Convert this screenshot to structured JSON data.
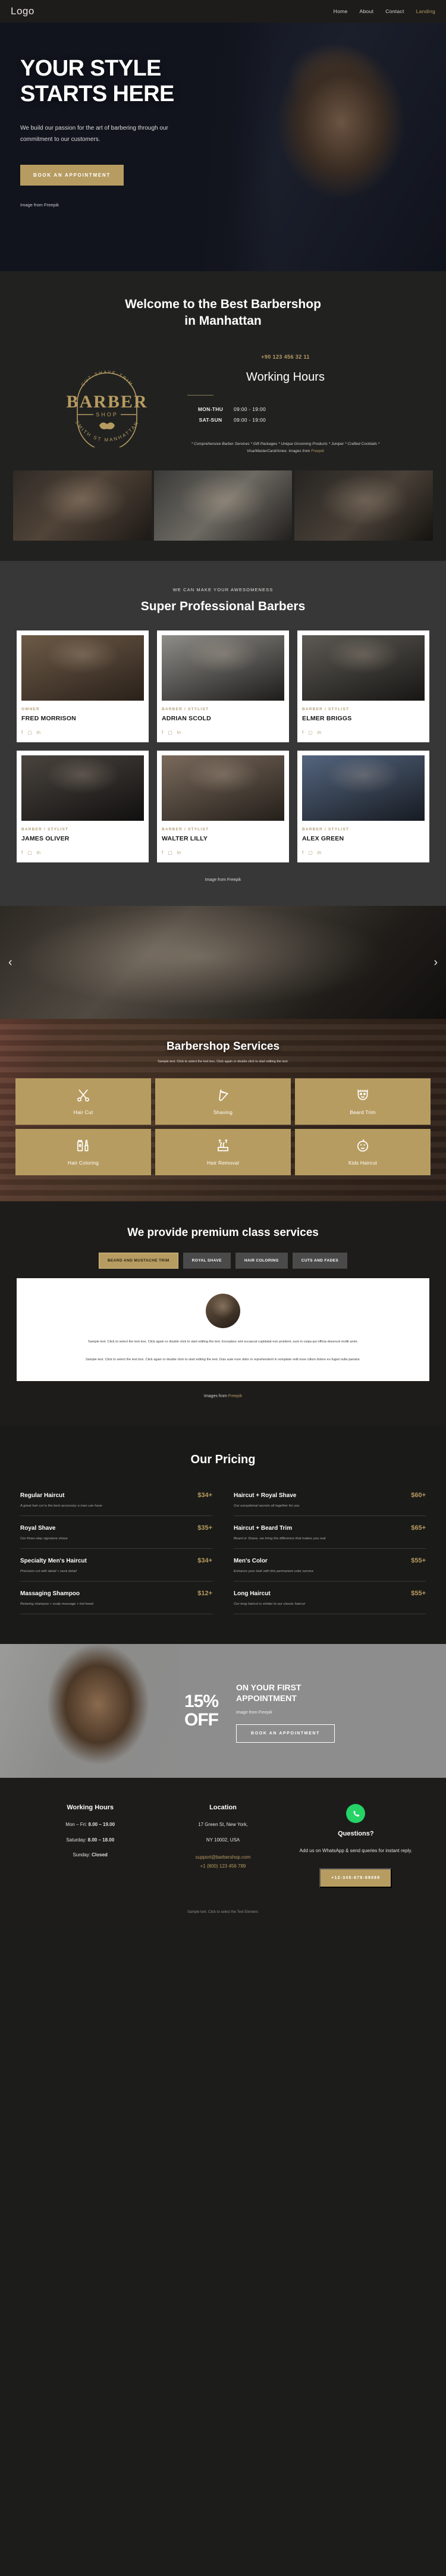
{
  "header": {
    "logo": "Logo",
    "nav": [
      {
        "label": "Home",
        "active": false
      },
      {
        "label": "About",
        "active": false
      },
      {
        "label": "Contact",
        "active": false
      },
      {
        "label": "Landing",
        "active": true
      }
    ]
  },
  "hero": {
    "title_line1": "YOUR STYLE",
    "title_line2": "STARTS HERE",
    "subtitle": "We build our passion for the art of barbering through our commitment to our customers.",
    "cta": "BOOK AN APPOINTMENT",
    "credit_prefix": "Image from ",
    "credit_link": "Freepik"
  },
  "welcome": {
    "title_line1": "Welcome to the Best Barbershop",
    "title_line2": "in Manhattan",
    "emblem": {
      "top_arc": "CUT·SHAVE·TRIM",
      "name": "BARBER",
      "sub": "SHOP",
      "bottom_arc": "SMITH ST MANHATTAN"
    },
    "phone": "+90 123 456 32 11",
    "hours_title": "Working Hours",
    "hours": [
      {
        "days": "MON-THU",
        "time": "09:00 - 19:00"
      },
      {
        "days": "SAT-SUN",
        "time": "09:00 - 19:00"
      }
    ],
    "fineprint": "* Comprehensive Barber Services * Gift Packages * Unique Grooming Products * Juniper * Crafted Cocktails *  Visa/MasterCard/Amex. Images from ",
    "fineprint_link": "Freepik"
  },
  "barbers": {
    "eyebrow": "WE CAN MAKE YOUR AWESOMENESS",
    "title": "Super Professional Barbers",
    "members": [
      {
        "role": "OWNER",
        "name": "FRED MORRISON"
      },
      {
        "role": "BARBER / STYLIST",
        "name": "ADRIAN SCOLD"
      },
      {
        "role": "BARBER / STYLIST",
        "name": "ELMER BRIGGS"
      },
      {
        "role": "BARBER / STYLIST",
        "name": "JAMES OLIVER"
      },
      {
        "role": "BARBER / STYLIST",
        "name": "WALTER LILLY"
      },
      {
        "role": "BARBER / STYLIST",
        "name": "ALEX GREEN"
      }
    ],
    "credit_prefix": "Image from ",
    "credit_link": "Freepik"
  },
  "slider": {
    "prev": "‹",
    "next": "›"
  },
  "services": {
    "title": "Barbershop Services",
    "subtitle": "Sample text. Click to select the text box. Click again or double click to start editing the text.",
    "items": [
      {
        "label": "Hair Cut",
        "icon": "scissors-icon"
      },
      {
        "label": "Shaving",
        "icon": "razor-icon"
      },
      {
        "label": "Beard Trim",
        "icon": "beard-icon"
      },
      {
        "label": "Hair Coloring",
        "icon": "color-tube-icon"
      },
      {
        "label": "Hair Removal",
        "icon": "hair-removal-icon"
      },
      {
        "label": "Kids Haircut",
        "icon": "baby-face-icon"
      }
    ]
  },
  "premium": {
    "title": "We provide premium class services",
    "tabs": [
      {
        "label": "BEARD AND MUSTACHE TRIM",
        "active": true
      },
      {
        "label": "ROYAL SHAVE",
        "active": false
      },
      {
        "label": "HAIR COLORING",
        "active": false
      },
      {
        "label": "CUTS AND FADES",
        "active": false
      }
    ],
    "body_line1": "Sample text. Click to select the text box. Click again or double click to start editing the text. Excepteur sint occaecat cupidatat non proident, sunt in culpa qui officia deserunt mollit anim.",
    "body_line2": "Sample text. Click to select the text box. Click again or double click to start editing the text. Duis aute irure dolor in reprehenderit in voluptate velit esse cillum dolore eu fugiat nulla pariatur.",
    "credit_prefix": "Images from ",
    "credit_link": "Freepik"
  },
  "pricing": {
    "title": "Our Pricing",
    "items": [
      {
        "name": "Regular Haircut",
        "price": "$34+",
        "desc": "A great hair cut is the best accessory a man can have"
      },
      {
        "name": "Haircut + Royal Shave",
        "price": "$60+",
        "desc": "Our exceptional secrets all together for you"
      },
      {
        "name": "Royal Shave",
        "price": "$35+",
        "desc": "Our three-step signature shave"
      },
      {
        "name": "Haircut + Beard Trim",
        "price": "$65+",
        "desc": "Beard or Shave, we bring the difference that makes you real"
      },
      {
        "name": "Specialty Men's Haircut",
        "price": "$34+",
        "desc": "Precision cut with detail + neck detail"
      },
      {
        "name": "Men's Color",
        "price": "$55+",
        "desc": "Enhance your look with this permanent color service"
      },
      {
        "name": "Massaging Shampoo",
        "price": "$12+",
        "desc": "Relaxing shampoo + scalp massage + hot towel"
      },
      {
        "name": "Long Haircut",
        "price": "$55+",
        "desc": "Our long haircut is similar to our classic haircut"
      }
    ]
  },
  "promo": {
    "percent": "15%",
    "off": "OFF",
    "heading_line1": "ON YOUR FIRST",
    "heading_line2": "APPOINTMENT",
    "credit_prefix": "Image from ",
    "credit_link": "Freepik",
    "cta": "BOOK AN APPOINTMENT"
  },
  "footer": {
    "hours_title": "Working Hours",
    "hours": [
      {
        "label": "Mon – Fri: ",
        "value": "8.00 – 19.00"
      },
      {
        "label": "Saturday: ",
        "value": "8.00 – 18.00"
      },
      {
        "label": "Sunday: ",
        "value": "Closed"
      }
    ],
    "location_title": "Location",
    "address_line1": "17 Green St, New York,",
    "address_line2": "NY 10002, USA",
    "email": "support@barbershop.com",
    "phone": "+1 (800) 123 456 789",
    "questions_title": "Questions?",
    "questions_text": "Add us on WhatsApp & send queries for instant reply.",
    "whatsapp_number": "+12-345-678-89089",
    "copyright_prefix": "Sample text. Click to select the Text Element.",
    "copyright_link": ""
  }
}
